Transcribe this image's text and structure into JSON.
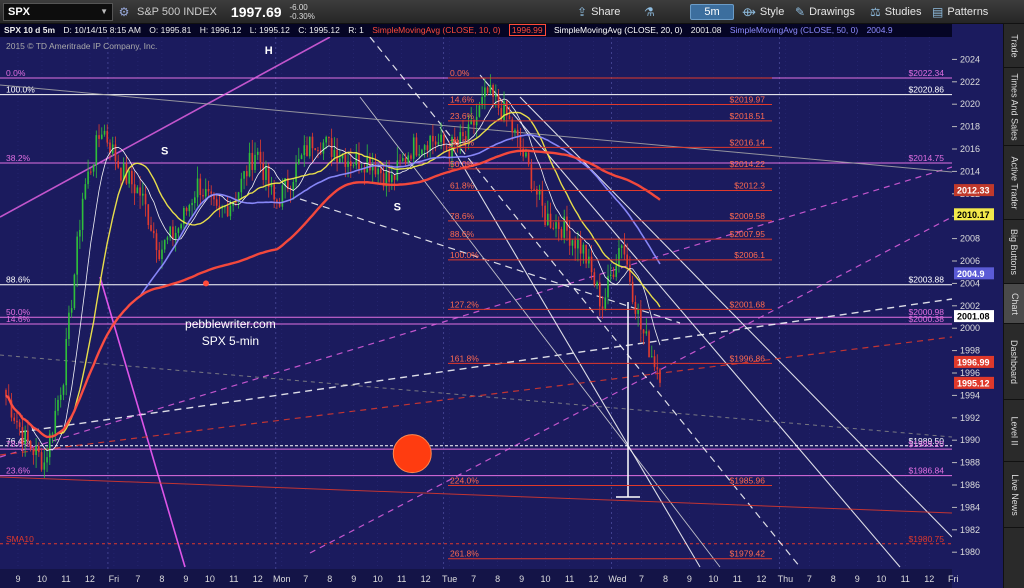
{
  "toolbar": {
    "symbol": "SPX",
    "index_name": "S&P 500 INDEX",
    "last": "1997.69",
    "change": "-6.00",
    "change_pct": "-0.30%",
    "share": "Share",
    "timeframe": "5m",
    "style": "Style",
    "drawings": "Drawings",
    "studies": "Studies",
    "patterns": "Patterns"
  },
  "info": {
    "title": "SPX 10 d 5m",
    "date": "D: 10/14/15 8:15 AM",
    "open": "O: 1995.81",
    "high": "H: 1996.12",
    "low": "L: 1995.12",
    "close": "C: 1995.12",
    "range": "R: 1",
    "sma10": "SimpleMovingAvg (CLOSE, 10, 0)",
    "sma10_val": "1996.99",
    "sma20": "SimpleMovingAvg (CLOSE, 20, 0)",
    "sma20_val": "2001.08",
    "sma50": "SimpleMovingAvg (CLOSE, 50, 0)",
    "sma50_val": "2004.9",
    "copyright": "2015 © TD Ameritrade IP Company, Inc."
  },
  "side_tabs": [
    "Trade",
    "Times And Sales",
    "Active Trader",
    "Big Buttons",
    "Chart",
    "Dashboard",
    "Level II",
    "Live News"
  ],
  "colors": {
    "background": "#1b1b5e",
    "sma10": "#ff4b3a",
    "sma20": "#f2e84a",
    "sma50": "#8d8cff",
    "candle_up": "#2fbf3a",
    "candle_down": "#e23b2e",
    "projection_marker": "#ff3c10"
  },
  "chart_data": {
    "type": "candlestick",
    "symbol": "SPX",
    "interval": "5m",
    "ylim": [
      1978.5,
      2026
    ],
    "yticks": [
      1980,
      1982,
      1984,
      1986,
      1988,
      1990,
      1992,
      1994,
      1996,
      1998,
      2000,
      2002,
      2004,
      2006,
      2008,
      2010,
      2012,
      2014,
      2016,
      2018,
      2020,
      2022,
      2024
    ],
    "x_labels": [
      "9",
      "10",
      "11",
      "12",
      "Fri",
      "7",
      "8",
      "9",
      "10",
      "11",
      "12",
      "Mon",
      "7",
      "8",
      "9",
      "10",
      "11",
      "12",
      "Tue",
      "7",
      "8",
      "9",
      "10",
      "11",
      "12",
      "Wed",
      "7",
      "8",
      "9",
      "10",
      "11",
      "12",
      "Thu",
      "7",
      "8",
      "9",
      "10",
      "11",
      "12",
      "Fri"
    ],
    "price_path": [
      [
        0,
        1994
      ],
      [
        1,
        1990
      ],
      [
        2,
        1988
      ],
      [
        3,
        1996
      ],
      [
        4,
        2012
      ],
      [
        5,
        2018
      ],
      [
        6,
        2014
      ],
      [
        7,
        2012
      ],
      [
        8,
        2007
      ],
      [
        9,
        2009
      ],
      [
        10,
        2013
      ],
      [
        11,
        2010
      ],
      [
        12,
        2012
      ],
      [
        13,
        2016
      ],
      [
        14,
        2011
      ],
      [
        15,
        2014
      ],
      [
        16,
        2017
      ],
      [
        17,
        2016
      ],
      [
        18,
        2015
      ],
      [
        19,
        2015
      ],
      [
        20,
        2013
      ],
      [
        21,
        2016
      ],
      [
        22,
        2017
      ],
      [
        23,
        2016
      ],
      [
        24,
        2017
      ],
      [
        25,
        2021
      ],
      [
        26,
        2019
      ],
      [
        27,
        2015
      ],
      [
        28,
        2010
      ],
      [
        29,
        2009
      ],
      [
        30,
        2007
      ],
      [
        31,
        2002
      ],
      [
        32,
        2008
      ],
      [
        33,
        2000
      ],
      [
        34,
        1996
      ]
    ],
    "bar_count": 240,
    "last_price": 1995.12,
    "axis_value_labels": [
      {
        "value": 2012.33,
        "label": "2012.33",
        "bg": "#c0392b",
        "fg": "#ffffff"
      },
      {
        "value": 2010.17,
        "label": "2010.17",
        "bg": "#f2e84a",
        "fg": "#000000"
      },
      {
        "value": 2004.9,
        "label": "2004.9",
        "bg": "#5b5bd6",
        "fg": "#ffffff"
      },
      {
        "value": 2001.08,
        "label": "2001.08",
        "bg": "#ffffff",
        "fg": "#000000"
      },
      {
        "value": 1996.99,
        "label": "1996.99",
        "bg": "#e0392b",
        "fg": "#ffffff"
      },
      {
        "value": 1995.12,
        "label": "1995.12",
        "bg": "#e0392b",
        "fg": "#ffffff"
      }
    ],
    "horizontal_levels": [
      {
        "value": 2022.34,
        "label": "0.0%",
        "right_label": "$2022.34",
        "color": "#e270e2"
      },
      {
        "value": 2020.86,
        "label": "100.0%",
        "right_label": "$2020.86",
        "color": "#ffffff"
      },
      {
        "value": 2014.75,
        "label": "38.2%",
        "right_label": "$2014.75",
        "color": "#e270e2"
      },
      {
        "value": 2003.88,
        "label": "88.6%",
        "right_label": "$2003.88",
        "color": "#ffffff"
      },
      {
        "value": 2000.98,
        "label": "50.0%",
        "right_label": "$2000.98",
        "color": "#e270e2"
      },
      {
        "value": 2000.38,
        "label": "14.6%",
        "right_label": "$2000.38",
        "color": "#e270e2"
      },
      {
        "value": 1989.5,
        "label": "76.4%",
        "right_label": "$1989.50",
        "color": "#ffffff"
      },
      {
        "value": 1989.2,
        "label": "78.6%",
        "right_label": "$1989.20",
        "color": "#e270e2"
      },
      {
        "value": 1986.84,
        "label": "23.6%",
        "right_label": "$1986.84",
        "color": "#e270e2"
      },
      {
        "value": 1980.75,
        "label": "SMA10",
        "right_label": "$1980.75",
        "color": "#e0392b"
      }
    ],
    "fib_levels": [
      {
        "value": 2022.34,
        "label": "0.0%"
      },
      {
        "value": 2019.97,
        "label": "14.6%",
        "right_label": "$2019.97"
      },
      {
        "value": 2018.51,
        "label": "23.6%",
        "right_label": "$2018.51"
      },
      {
        "value": 2016.14,
        "label": "38.2%",
        "right_label": "$2016.14"
      },
      {
        "value": 2014.22,
        "label": "50.0%",
        "right_label": "$2014.22"
      },
      {
        "value": 2012.3,
        "label": "61.8%",
        "right_label": "$2012.3"
      },
      {
        "value": 2009.58,
        "label": "78.6%",
        "right_label": "$2009.58"
      },
      {
        "value": 2007.95,
        "label": "88.6%",
        "right_label": "$2007.95"
      },
      {
        "value": 2006.1,
        "label": "100.0%",
        "right_label": "$2006.1"
      },
      {
        "value": 2001.68,
        "label": "127.2%",
        "right_label": "$2001.68"
      },
      {
        "value": 1996.86,
        "label": "161.8%",
        "right_label": "$1996.86"
      },
      {
        "value": 1985.96,
        "label": "224.0%",
        "right_label": "$1985.96"
      },
      {
        "value": 1979.42,
        "label": "261.8%",
        "right_label": "$1979.42"
      }
    ],
    "annotations": [
      {
        "text": "S",
        "bar_index": 58,
        "value": 2015.5
      },
      {
        "text": "H",
        "bar_index": 96,
        "value": 2024.5
      },
      {
        "text": "S",
        "bar_index": 143,
        "value": 2010.5
      },
      {
        "text": "pebblewriter.com",
        "bar_index": 82,
        "value": 2000
      },
      {
        "text": "SPX 5-min",
        "bar_index": 82,
        "value": 1998.5
      }
    ],
    "projection_marker": {
      "bar_index": 147,
      "value": 1988.8
    }
  }
}
